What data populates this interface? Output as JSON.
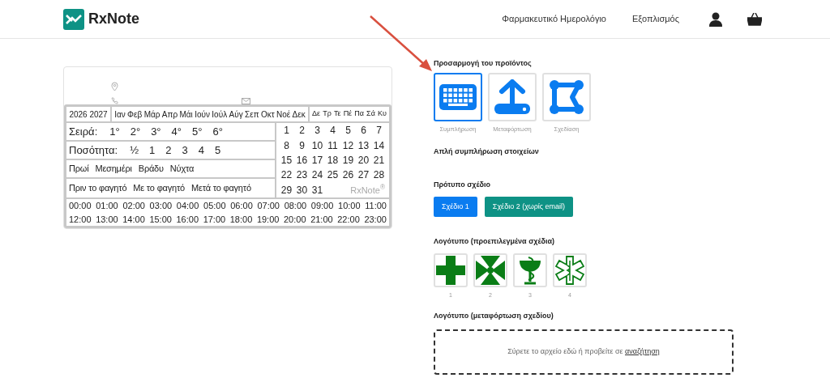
{
  "header": {
    "logo": "RxNote",
    "nav": [
      "Φαρμακευτικό Ημερολόγιο",
      "Εξοπλισμός"
    ]
  },
  "preview": {
    "years": [
      "2026",
      "2027"
    ],
    "months": [
      "Ιαν",
      "Φεβ",
      "Μάρ",
      "Απρ",
      "Μάι",
      "Ιούν",
      "Ιούλ",
      "Αύγ",
      "Σεπ",
      "Οκτ",
      "Νοέ",
      "Δεκ"
    ],
    "weekdays": [
      "Δε",
      "Τρ",
      "Τε",
      "Πέ",
      "Πα",
      "Σά",
      "Κυ"
    ],
    "rows": [
      {
        "label": "Σειρά:",
        "items": [
          "1°",
          "2°",
          "3°",
          "4°",
          "5°",
          "6°"
        ]
      },
      {
        "label": "Ποσότητα:",
        "items": [
          "½",
          "1",
          "2",
          "3",
          "4",
          "5"
        ]
      },
      {
        "items": [
          "Πρωί",
          "Μεσημέρι",
          "Βράδυ",
          "Νύχτα"
        ]
      },
      {
        "items": [
          "Πριν το φαγητό",
          "Με το φαγητό",
          "Μετά το φαγητό"
        ]
      }
    ],
    "days": [
      "1",
      "2",
      "3",
      "4",
      "5",
      "6",
      "7",
      "8",
      "9",
      "10",
      "11",
      "12",
      "13",
      "14",
      "15",
      "16",
      "17",
      "18",
      "19",
      "20",
      "21",
      "22",
      "23",
      "24",
      "25",
      "26",
      "27",
      "28",
      "29",
      "30",
      "31"
    ],
    "brand": "RxNote$^{®}$",
    "hours": [
      [
        "00:00",
        "01:00",
        "02:00",
        "03:00",
        "04:00",
        "05:00",
        "06:00",
        "07:00",
        "08:00",
        "09:00",
        "10:00",
        "11:00"
      ],
      [
        "12:00",
        "13:00",
        "14:00",
        "15:00",
        "16:00",
        "17:00",
        "18:00",
        "19:00",
        "20:00",
        "21:00",
        "22:00",
        "23:00"
      ]
    ]
  },
  "customize": {
    "title": "Προσαρμογή του προϊόντος",
    "modes": [
      {
        "kind": "keyboard",
        "label": "Συμπλήρωση",
        "selected": true
      },
      {
        "kind": "upload",
        "label": "Μεταφόρτωση",
        "selected": false
      },
      {
        "kind": "design",
        "label": "Σχεδίαση",
        "selected": false
      }
    ],
    "mode_heading": "Απλή συμπλήρωση στοιχείων",
    "template_title": "Πρότυπο σχέδιο",
    "templates": [
      {
        "label": "Σχέδιο 1",
        "selected": true
      },
      {
        "label": "Σχέδιο 2 (χωρίς email)",
        "selected": false
      }
    ],
    "logo_title": "Λογότυπο (προεπιλεγμένα σχέδια)",
    "logos": [
      {
        "kind": "cross",
        "label": "1",
        "selected": false
      },
      {
        "kind": "maltese",
        "label": "2",
        "selected": false
      },
      {
        "kind": "hygieia",
        "label": "3",
        "selected": false
      },
      {
        "kind": "star",
        "label": "4",
        "selected": false
      }
    ],
    "upload_title": "Λογότυπο (μεταφόρτωση σχεδίου)",
    "upload_text": "Σύρετε το αρχείο εδώ ή προβείτε σε",
    "upload_link": "αναζήτηση"
  }
}
